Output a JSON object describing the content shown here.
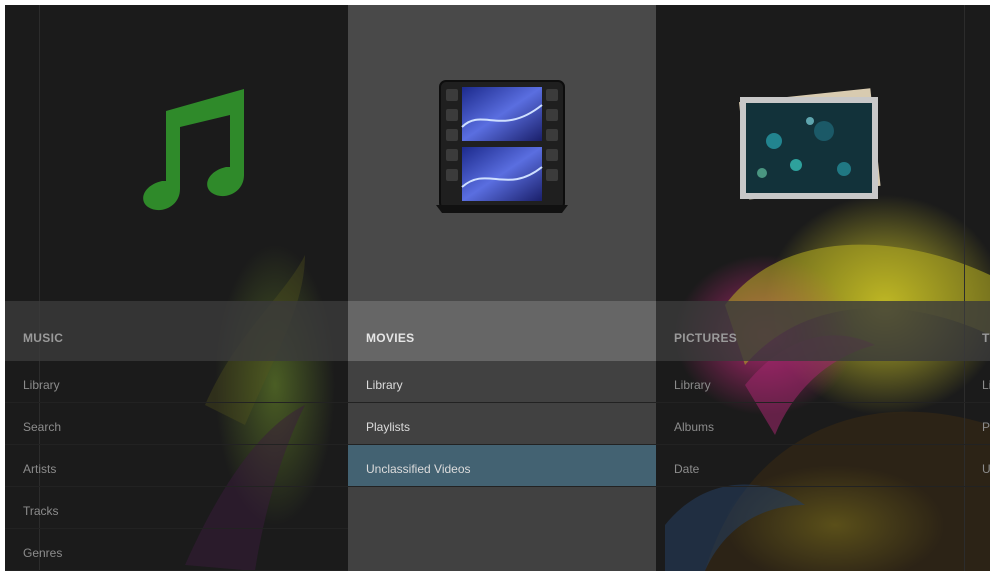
{
  "categories": [
    {
      "title": "MUSIC",
      "icon": "music-note-icon",
      "items": [
        "Library",
        "Search",
        "Artists",
        "Tracks",
        "Genres"
      ]
    },
    {
      "title": "MOVIES",
      "icon": "film-reel-icon",
      "items": [
        "Library",
        "Playlists",
        "Unclassified Videos"
      ],
      "selected": true,
      "active_item": "Unclassified Videos"
    },
    {
      "title": "PICTURES",
      "icon": "photo-stack-icon",
      "items": [
        "Library",
        "Albums",
        "Date"
      ]
    },
    {
      "title": "TV",
      "items": [
        "Lib",
        "Pl",
        "Un"
      ]
    }
  ],
  "colors": {
    "background": "#1b1b1b",
    "selected_tile": "#494949",
    "selected_header": "#666666",
    "active_item": "#436272",
    "music_icon": "#2f8a2a"
  }
}
